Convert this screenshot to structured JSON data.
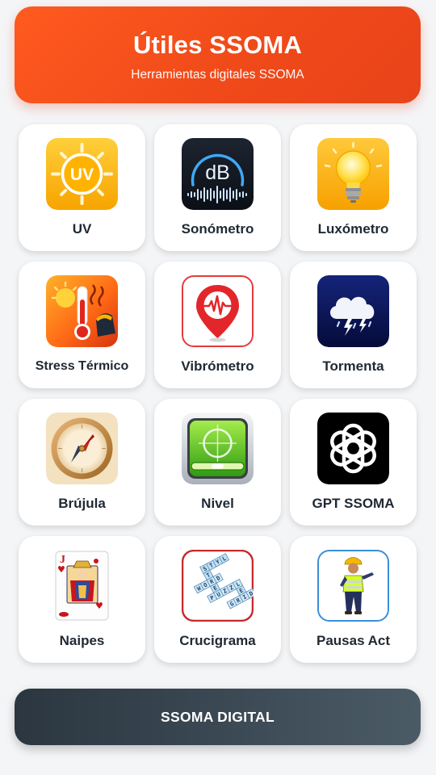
{
  "header": {
    "title": "Útiles SSOMA",
    "subtitle": "Herramientas digitales SSOMA"
  },
  "tools": [
    {
      "label": "UV",
      "icon": "uv-sun-icon",
      "icon_text": "UV"
    },
    {
      "label": "Sonómetro",
      "icon": "decibel-meter-icon",
      "icon_text": "dB"
    },
    {
      "label": "Luxómetro",
      "icon": "light-bulb-icon"
    },
    {
      "label": "Stress Térmico",
      "icon": "thermometer-heat-icon"
    },
    {
      "label": "Vibrómetro",
      "icon": "vibration-pin-icon"
    },
    {
      "label": "Tormenta",
      "icon": "storm-cloud-icon"
    },
    {
      "label": "Brújula",
      "icon": "compass-icon"
    },
    {
      "label": "Nivel",
      "icon": "spirit-level-icon"
    },
    {
      "label": "GPT SSOMA",
      "icon": "openai-knot-icon"
    },
    {
      "label": "Naipes",
      "icon": "playing-card-jack-icon",
      "icon_text": "J"
    },
    {
      "label": "Crucigrama",
      "icon": "crossword-cubes-icon",
      "icon_text": "STYL WORD PUZZLE GRID"
    },
    {
      "label": "Pausas Act",
      "icon": "worker-exercise-icon"
    }
  ],
  "footer": {
    "label": "SSOMA DIGITAL"
  }
}
